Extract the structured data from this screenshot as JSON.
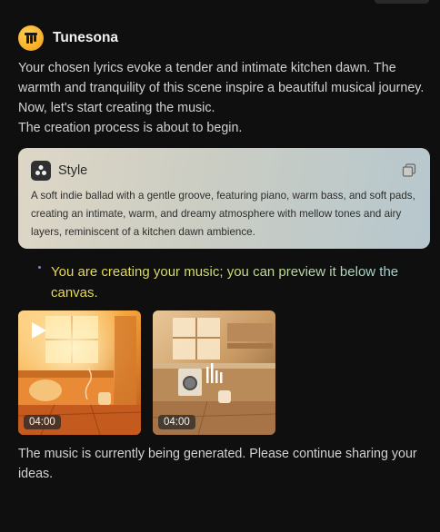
{
  "app": {
    "name": "Tunesona",
    "logo_icon": "tunesona-logo-icon",
    "accent": "#f5b21c"
  },
  "message": {
    "intro_line1": "Your chosen lyrics evoke a tender and intimate kitchen dawn. The warmth and tranquility of this scene inspire a beautiful musical journey. Now, let's start creating the music.",
    "intro_line2": "The creation process is about to begin."
  },
  "style_card": {
    "title": "Style",
    "description": "A soft indie ballad with a gentle groove, featuring piano, warm bass, and soft pads, creating an intimate, warm, and dreamy atmosphere with mellow tones and airy layers, reminiscent of a kitchen dawn ambience.",
    "icon": "style-dots-icon",
    "copy_icon": "copy-icon"
  },
  "status": {
    "text": "You are creating your music; you can preview it below the canvas."
  },
  "tracks": [
    {
      "duration": "04:00",
      "state_icon": "play-icon"
    },
    {
      "duration": "04:00",
      "state_icon": "equalizer-bars-icon"
    }
  ],
  "footer": {
    "text": "The music is currently being generated. Please continue sharing your ideas."
  }
}
